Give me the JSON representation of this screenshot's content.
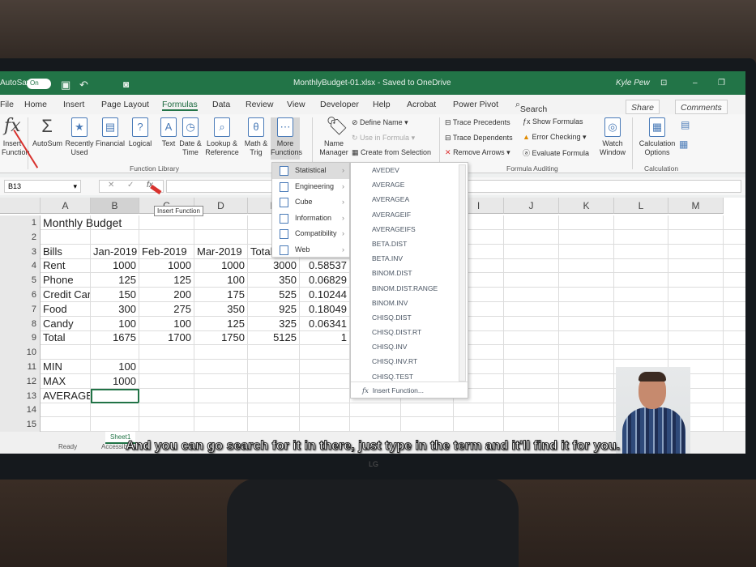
{
  "window": {
    "autosave_label": "AutoSave",
    "autosave_state": "On",
    "title": "MonthlyBudget-01.xlsx - Saved to OneDrive",
    "user": "Kyle Pew"
  },
  "tabs": [
    "File",
    "Home",
    "Insert",
    "Page Layout",
    "Formulas",
    "Data",
    "Review",
    "View",
    "Developer",
    "Help",
    "Acrobat",
    "Power Pivot"
  ],
  "active_tab": "Formulas",
  "search_label": "Search",
  "share_label": "Share",
  "comments_label": "Comments",
  "ribbon": {
    "insert_function": "Insert Function",
    "function_library": [
      {
        "label": "AutoSum",
        "icon": "Σ"
      },
      {
        "label": "Recently Used",
        "icon": "★"
      },
      {
        "label": "Financial",
        "icon": "▤"
      },
      {
        "label": "Logical",
        "icon": "?"
      },
      {
        "label": "Text",
        "icon": "A"
      },
      {
        "label": "Date & Time",
        "icon": "◷"
      },
      {
        "label": "Lookup & Reference",
        "icon": "⌕"
      },
      {
        "label": "Math & Trig",
        "icon": "θ"
      },
      {
        "label": "More Functions",
        "icon": "⋯"
      }
    ],
    "function_library_group": "Function Library",
    "name_manager": "Name Manager",
    "define_name": "Define Name",
    "use_in_formula": "Use in Formula",
    "create_from_selection": "Create from Selection",
    "trace_precedents": "Trace Precedents",
    "trace_dependents": "Trace Dependents",
    "remove_arrows": "Remove Arrows",
    "show_formulas": "Show Formulas",
    "error_checking": "Error Checking",
    "evaluate_formula": "Evaluate Formula",
    "watch_window": "Watch Window",
    "formula_auditing_group": "Formula Auditing",
    "calculation_options": "Calculation Options",
    "calculation_group": "Calculation"
  },
  "formula_bar": {
    "name_box": "B13",
    "fx": "fx",
    "tooltip": "Insert Function"
  },
  "columns": [
    "A",
    "B",
    "C",
    "D",
    "E",
    "F",
    "G",
    "H",
    "I",
    "J",
    "K",
    "L",
    "M"
  ],
  "rows": [
    {
      "n": "1",
      "cells": [
        "Monthly Budget",
        "",
        "",
        "",
        "",
        ""
      ]
    },
    {
      "n": "2",
      "cells": [
        "",
        "",
        "",
        "",
        "",
        ""
      ]
    },
    {
      "n": "3",
      "cells": [
        "Bills",
        "Jan-2019",
        "Feb-2019",
        "Mar-2019",
        "Total",
        "Percent"
      ]
    },
    {
      "n": "4",
      "cells": [
        "Rent",
        "1000",
        "1000",
        "1000",
        "3000",
        "0.58537"
      ]
    },
    {
      "n": "5",
      "cells": [
        "Phone",
        "125",
        "125",
        "100",
        "350",
        "0.06829"
      ]
    },
    {
      "n": "6",
      "cells": [
        "Credit Card",
        "150",
        "200",
        "175",
        "525",
        "0.10244"
      ]
    },
    {
      "n": "7",
      "cells": [
        "Food",
        "300",
        "275",
        "350",
        "925",
        "0.18049"
      ]
    },
    {
      "n": "8",
      "cells": [
        "Candy",
        "100",
        "100",
        "125",
        "325",
        "0.06341"
      ]
    },
    {
      "n": "9",
      "cells": [
        "Total",
        "1675",
        "1700",
        "1750",
        "5125",
        "1"
      ]
    },
    {
      "n": "10",
      "cells": [
        "",
        "",
        "",
        "",
        "",
        ""
      ]
    },
    {
      "n": "11",
      "cells": [
        "MIN",
        "100",
        "",
        "",
        "",
        ""
      ]
    },
    {
      "n": "12",
      "cells": [
        "MAX",
        "1000",
        "",
        "",
        "",
        ""
      ]
    },
    {
      "n": "13",
      "cells": [
        "AVERAGE",
        "",
        "",
        "",
        "",
        ""
      ]
    },
    {
      "n": "14",
      "cells": [
        "",
        "",
        "",
        "",
        "",
        ""
      ]
    },
    {
      "n": "15",
      "cells": [
        "",
        "",
        "",
        "",
        "",
        ""
      ]
    }
  ],
  "more_functions_menu": [
    "Statistical",
    "Engineering",
    "Cube",
    "Information",
    "Compatibility",
    "Web"
  ],
  "statistical_functions": [
    "AVEDEV",
    "AVERAGE",
    "AVERAGEA",
    "AVERAGEIF",
    "AVERAGEIFS",
    "BETA.DIST",
    "BETA.INV",
    "BINOM.DIST",
    "BINOM.DIST.RANGE",
    "BINOM.INV",
    "CHISQ.DIST",
    "CHISQ.DIST.RT",
    "CHISQ.INV",
    "CHISQ.INV.RT",
    "CHISQ.TEST"
  ],
  "insert_function_footer": "Insert Function...",
  "status": {
    "ready": "Ready",
    "sheet": "Sheet1",
    "accessibility": "Accessibility"
  },
  "caption": "And you can go search for it in there, just type in the term and it'll find it for you.",
  "monitor_brand": "LG",
  "colors": {
    "excel_green": "#227447",
    "arrow_red": "#d8322e"
  }
}
